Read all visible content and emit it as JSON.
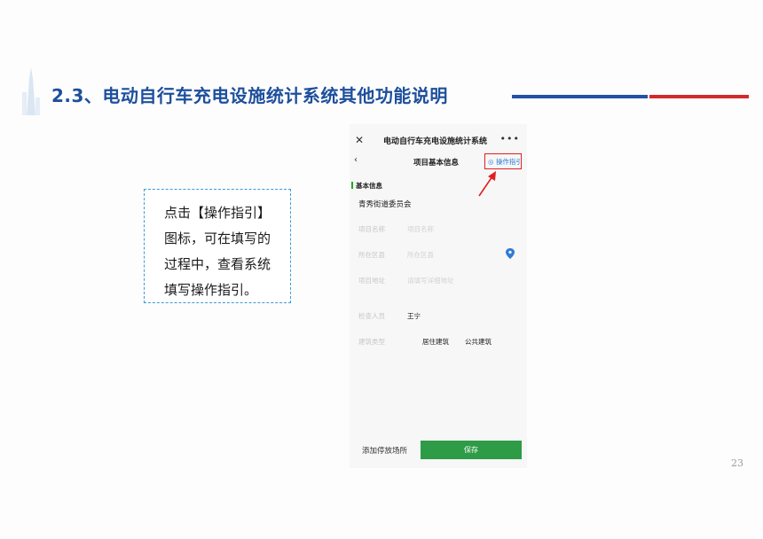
{
  "slide": {
    "title": "2.3、电动自行车充电设施统计系统其他功能说明",
    "page_number": "23",
    "accent_blue": "#2451a3",
    "accent_red": "#d22a2c"
  },
  "callout": {
    "lines": [
      "点击【操作指引】",
      "图标，可在填写的",
      "过程中，查看系统",
      "填写操作指引。"
    ]
  },
  "phone": {
    "app_title": "电动自行车充电设施统计系统",
    "close_icon": "close-icon",
    "more_icon": "more-icon",
    "page_title": "项目基本信息",
    "guide_label": "操作指引",
    "section_title": "基本信息",
    "org_name": "青秀街道委员会",
    "fields": [
      {
        "label": "项目名称",
        "value": "项目名称"
      },
      {
        "label": "所在区县",
        "value": "所在区县"
      },
      {
        "label": "项目地址",
        "value": "请填写详细地址"
      },
      {
        "label": "检查人员",
        "value": "王宁"
      },
      {
        "label": "建筑类型",
        "options": [
          "居住建筑",
          "公共建筑"
        ]
      }
    ],
    "add_parking_label": "添加停放场所",
    "save_label": "保存",
    "save_color": "#2e9b47",
    "highlight_color": "#e02020"
  }
}
